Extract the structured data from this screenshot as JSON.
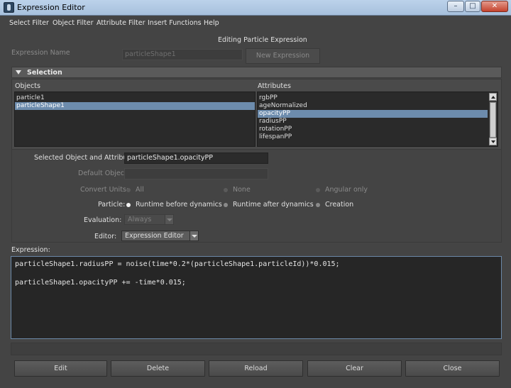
{
  "window": {
    "title": "Expression Editor",
    "minimize": "–",
    "maximize": "□",
    "close": "✕"
  },
  "menu": [
    "Select Filter",
    "Object Filter",
    "Attribute Filter",
    "Insert Functions",
    "Help"
  ],
  "header": {
    "mode_label": "Editing Particle Expression"
  },
  "expression_name": {
    "label": "Expression Name",
    "value": "particleShape1",
    "new_button": "New Expression"
  },
  "selection": {
    "title": "Selection",
    "objects_label": "Objects",
    "attributes_label": "Attributes",
    "objects": [
      "particle1",
      "particleShape1"
    ],
    "selected_object_index": 1,
    "attributes": [
      "rgbPP",
      "ageNormalized",
      "opacityPP",
      "radiusPP",
      "rotationPP",
      "lifespanPP"
    ],
    "selected_attribute_index": 2
  },
  "options": {
    "selected_obj_attr_label": "Selected Object and Attribute:",
    "selected_obj_attr_value": "particleShape1.opacityPP",
    "default_object_label": "Default Object:",
    "default_object_value": "",
    "convert_units_label": "Convert Units:",
    "convert_units": [
      "All",
      "None",
      "Angular only"
    ],
    "particle_label": "Particle:",
    "particle_options": [
      "Runtime before dynamics",
      "Runtime after dynamics",
      "Creation"
    ],
    "evaluation_label": "Evaluation:",
    "evaluation_value": "Always",
    "editor_label": "Editor:",
    "editor_value": "Expression Editor"
  },
  "expression": {
    "label": "Expression:",
    "lines": [
      "particleShape1.radiusPP = noise(time*0.2*(particleShape1.particleId))*0.015;",
      "",
      "particleShape1.opacityPP += -time*0.015;"
    ]
  },
  "buttons": {
    "edit": "Edit",
    "delete": "Delete",
    "reload": "Reload",
    "clear": "Clear",
    "close": "Close"
  },
  "colors": {
    "accent_selection": "#6d8cad",
    "editor_border": "#6b88a8",
    "background": "#444444"
  }
}
